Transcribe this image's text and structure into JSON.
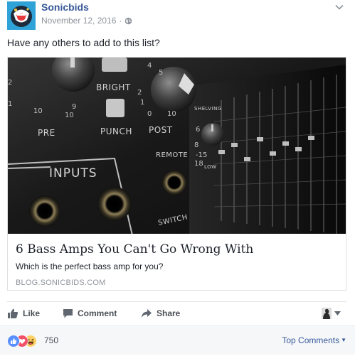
{
  "post": {
    "page_name": "Sonicbids",
    "date": "November 12, 2016",
    "separator": "·",
    "caption": "Have any others to add to this list?",
    "privacy_icon": "globe-icon"
  },
  "link_preview": {
    "title": "6 Bass Amps You Can't Go Wrong With",
    "description": "Which is the perfect bass amp for you?",
    "domain": "BLOG.SONICBIDS.COM",
    "image_labels": {
      "bright": "BRIGHT",
      "pre": "PRE",
      "punch": "PUNCH",
      "post": "POST",
      "inputs": "INPUTS",
      "remote": "REMOTE",
      "switch": "SWITCH",
      "shelving": "SHELVING",
      "low": "LOW"
    }
  },
  "actions": {
    "like": "Like",
    "comment": "Comment",
    "share": "Share"
  },
  "reactions": {
    "types": [
      "like",
      "love",
      "haha"
    ],
    "count": "750",
    "sort_label": "Top Comments",
    "sort_caret": "▼"
  },
  "colors": {
    "link": "#365899",
    "meta": "#90949c",
    "text": "#1d2129",
    "brand_avatar": "#2fa3d8",
    "like_blue": "#5890ff",
    "love_red": "#f25268",
    "haha_yellow": "#fcd063"
  }
}
